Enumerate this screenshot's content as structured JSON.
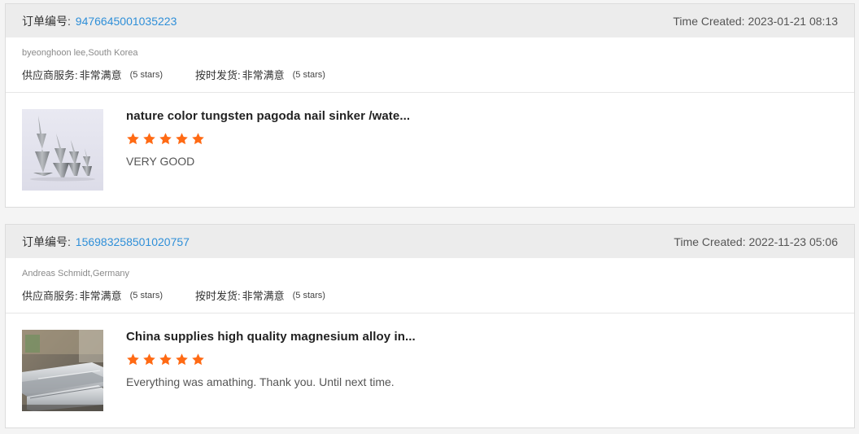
{
  "colors": {
    "accent_link": "#2f8fd8",
    "star": "#ff6a14",
    "header_bg": "#ececec"
  },
  "reviews": [
    {
      "order_label": "订单编号:",
      "order_number": "9476645001035223",
      "time_created": "Time Created: 2023-01-21 08:13",
      "buyer": "byeonghoon lee,South Korea",
      "supplier_service_label": "供应商服务:",
      "supplier_service_value": "非常满意",
      "supplier_service_stars": "(5 stars)",
      "on_time_label": "按时发货:",
      "on_time_value": "非常满意",
      "on_time_stars": "(5 stars)",
      "product_title": "nature color tungsten pagoda nail sinker /wate...",
      "product_thumb_icon": "tungsten-sinker-thumbnail",
      "rating": 5,
      "comment": "VERY GOOD"
    },
    {
      "order_label": "订单编号:",
      "order_number": "156983258501020757",
      "time_created": "Time Created: 2022-11-23 05:06",
      "buyer": "Andreas Schmidt,Germany",
      "supplier_service_label": "供应商服务:",
      "supplier_service_value": "非常满意",
      "supplier_service_stars": "(5 stars)",
      "on_time_label": "按时发货:",
      "on_time_value": "非常满意",
      "on_time_stars": "(5 stars)",
      "product_title": "China supplies high quality magnesium alloy in...",
      "product_thumb_icon": "magnesium-alloy-thumbnail",
      "rating": 5,
      "comment": "Everything was amathing. Thank you. Until next time."
    }
  ]
}
